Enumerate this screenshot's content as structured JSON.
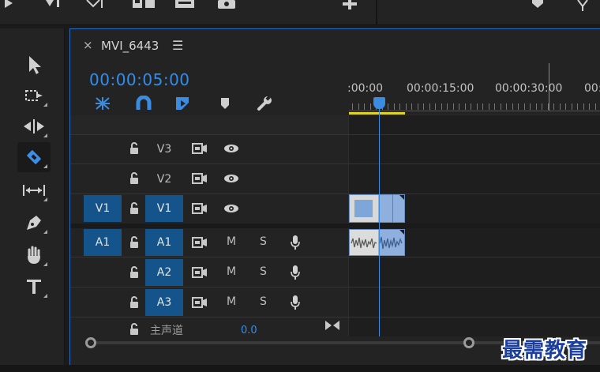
{
  "sequence": {
    "name": "MVI_6443",
    "close_glyph": "×",
    "menu_glyph": "☰",
    "timecode": "00:00:05:00"
  },
  "ruler": {
    "labels": [
      ":00:00",
      "00:00:15:00",
      "00:00:30:00",
      "00:"
    ]
  },
  "tracks": {
    "video": [
      {
        "target": "V3",
        "source": "",
        "target_on": false
      },
      {
        "target": "V2",
        "source": "",
        "target_on": false
      },
      {
        "target": "V1",
        "source": "V1",
        "target_on": true
      }
    ],
    "audio": [
      {
        "target": "A1",
        "source": "A1",
        "target_on": true,
        "mute": "M",
        "solo": "S"
      },
      {
        "target": "A2",
        "source": "",
        "target_on": true,
        "mute": "M",
        "solo": "S"
      },
      {
        "target": "A3",
        "source": "",
        "target_on": true,
        "mute": "M",
        "solo": "S"
      }
    ],
    "master": {
      "label": "主声道",
      "value": "0.0"
    }
  },
  "watermark": "最需教育",
  "colors": {
    "accent_blue": "#2f8ef0",
    "patch_blue": "#14548a",
    "work_area": "#e1d323",
    "clip_blue": "#8fb0dc"
  }
}
